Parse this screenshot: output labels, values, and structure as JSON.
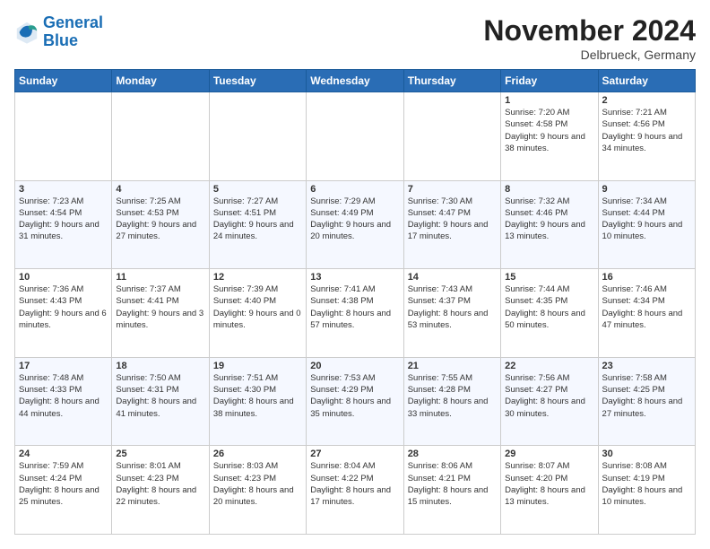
{
  "logo": {
    "line1": "General",
    "line2": "Blue"
  },
  "title": "November 2024",
  "location": "Delbrueck, Germany",
  "weekdays": [
    "Sunday",
    "Monday",
    "Tuesday",
    "Wednesday",
    "Thursday",
    "Friday",
    "Saturday"
  ],
  "weeks": [
    [
      {
        "day": "",
        "info": ""
      },
      {
        "day": "",
        "info": ""
      },
      {
        "day": "",
        "info": ""
      },
      {
        "day": "",
        "info": ""
      },
      {
        "day": "",
        "info": ""
      },
      {
        "day": "1",
        "info": "Sunrise: 7:20 AM\nSunset: 4:58 PM\nDaylight: 9 hours and 38 minutes."
      },
      {
        "day": "2",
        "info": "Sunrise: 7:21 AM\nSunset: 4:56 PM\nDaylight: 9 hours and 34 minutes."
      }
    ],
    [
      {
        "day": "3",
        "info": "Sunrise: 7:23 AM\nSunset: 4:54 PM\nDaylight: 9 hours and 31 minutes."
      },
      {
        "day": "4",
        "info": "Sunrise: 7:25 AM\nSunset: 4:53 PM\nDaylight: 9 hours and 27 minutes."
      },
      {
        "day": "5",
        "info": "Sunrise: 7:27 AM\nSunset: 4:51 PM\nDaylight: 9 hours and 24 minutes."
      },
      {
        "day": "6",
        "info": "Sunrise: 7:29 AM\nSunset: 4:49 PM\nDaylight: 9 hours and 20 minutes."
      },
      {
        "day": "7",
        "info": "Sunrise: 7:30 AM\nSunset: 4:47 PM\nDaylight: 9 hours and 17 minutes."
      },
      {
        "day": "8",
        "info": "Sunrise: 7:32 AM\nSunset: 4:46 PM\nDaylight: 9 hours and 13 minutes."
      },
      {
        "day": "9",
        "info": "Sunrise: 7:34 AM\nSunset: 4:44 PM\nDaylight: 9 hours and 10 minutes."
      }
    ],
    [
      {
        "day": "10",
        "info": "Sunrise: 7:36 AM\nSunset: 4:43 PM\nDaylight: 9 hours and 6 minutes."
      },
      {
        "day": "11",
        "info": "Sunrise: 7:37 AM\nSunset: 4:41 PM\nDaylight: 9 hours and 3 minutes."
      },
      {
        "day": "12",
        "info": "Sunrise: 7:39 AM\nSunset: 4:40 PM\nDaylight: 9 hours and 0 minutes."
      },
      {
        "day": "13",
        "info": "Sunrise: 7:41 AM\nSunset: 4:38 PM\nDaylight: 8 hours and 57 minutes."
      },
      {
        "day": "14",
        "info": "Sunrise: 7:43 AM\nSunset: 4:37 PM\nDaylight: 8 hours and 53 minutes."
      },
      {
        "day": "15",
        "info": "Sunrise: 7:44 AM\nSunset: 4:35 PM\nDaylight: 8 hours and 50 minutes."
      },
      {
        "day": "16",
        "info": "Sunrise: 7:46 AM\nSunset: 4:34 PM\nDaylight: 8 hours and 47 minutes."
      }
    ],
    [
      {
        "day": "17",
        "info": "Sunrise: 7:48 AM\nSunset: 4:33 PM\nDaylight: 8 hours and 44 minutes."
      },
      {
        "day": "18",
        "info": "Sunrise: 7:50 AM\nSunset: 4:31 PM\nDaylight: 8 hours and 41 minutes."
      },
      {
        "day": "19",
        "info": "Sunrise: 7:51 AM\nSunset: 4:30 PM\nDaylight: 8 hours and 38 minutes."
      },
      {
        "day": "20",
        "info": "Sunrise: 7:53 AM\nSunset: 4:29 PM\nDaylight: 8 hours and 35 minutes."
      },
      {
        "day": "21",
        "info": "Sunrise: 7:55 AM\nSunset: 4:28 PM\nDaylight: 8 hours and 33 minutes."
      },
      {
        "day": "22",
        "info": "Sunrise: 7:56 AM\nSunset: 4:27 PM\nDaylight: 8 hours and 30 minutes."
      },
      {
        "day": "23",
        "info": "Sunrise: 7:58 AM\nSunset: 4:25 PM\nDaylight: 8 hours and 27 minutes."
      }
    ],
    [
      {
        "day": "24",
        "info": "Sunrise: 7:59 AM\nSunset: 4:24 PM\nDaylight: 8 hours and 25 minutes."
      },
      {
        "day": "25",
        "info": "Sunrise: 8:01 AM\nSunset: 4:23 PM\nDaylight: 8 hours and 22 minutes."
      },
      {
        "day": "26",
        "info": "Sunrise: 8:03 AM\nSunset: 4:23 PM\nDaylight: 8 hours and 20 minutes."
      },
      {
        "day": "27",
        "info": "Sunrise: 8:04 AM\nSunset: 4:22 PM\nDaylight: 8 hours and 17 minutes."
      },
      {
        "day": "28",
        "info": "Sunrise: 8:06 AM\nSunset: 4:21 PM\nDaylight: 8 hours and 15 minutes."
      },
      {
        "day": "29",
        "info": "Sunrise: 8:07 AM\nSunset: 4:20 PM\nDaylight: 8 hours and 13 minutes."
      },
      {
        "day": "30",
        "info": "Sunrise: 8:08 AM\nSunset: 4:19 PM\nDaylight: 8 hours and 10 minutes."
      }
    ]
  ]
}
